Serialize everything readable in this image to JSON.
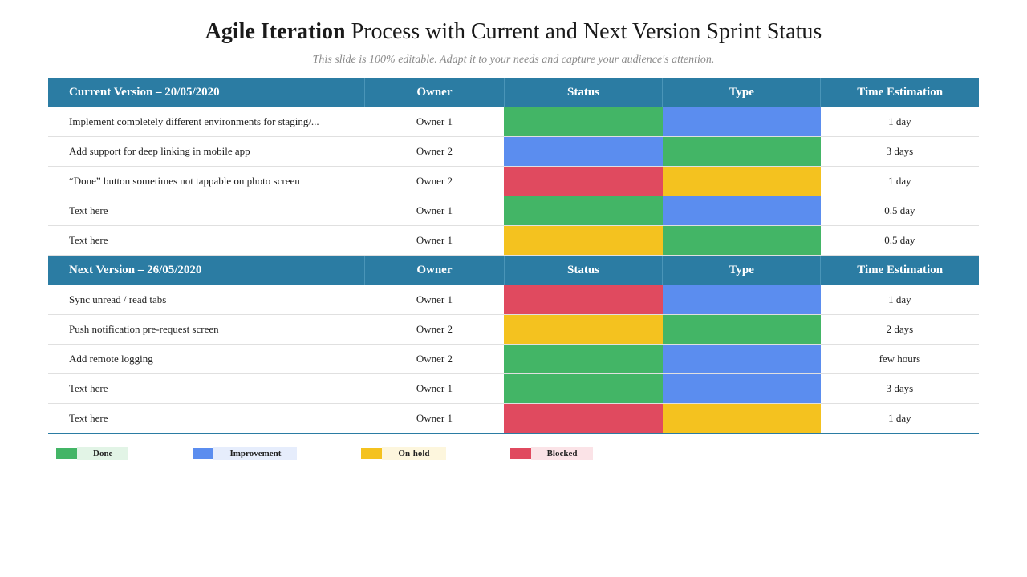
{
  "title_bold": "Agile Iteration",
  "title_rest": " Process with Current and Next Version Sprint Status",
  "subtitle": "This slide is 100% editable. Adapt it to your needs and capture your audience's attention.",
  "colors": {
    "done": "#43b566",
    "improvement": "#5b8def",
    "onhold": "#f4c21f",
    "blocked": "#e04a5f"
  },
  "columns": [
    "Owner",
    "Status",
    "Type",
    "Time Estimation"
  ],
  "sections": [
    {
      "title": "Current Version – 20/05/2020",
      "rows": [
        {
          "task": "Implement completely different environments for staging/...",
          "owner": "Owner 1",
          "status": "done",
          "type": "improvement",
          "time": "1 day"
        },
        {
          "task": "Add support for deep linking in mobile app",
          "owner": "Owner 2",
          "status": "improvement",
          "type": "done",
          "time": "3 days"
        },
        {
          "task": "“Done” button sometimes not tappable on photo screen",
          "owner": "Owner 2",
          "status": "blocked",
          "type": "onhold",
          "time": "1 day"
        },
        {
          "task": "Text here",
          "owner": "Owner 1",
          "status": "done",
          "type": "improvement",
          "time": "0.5 day"
        },
        {
          "task": "Text here",
          "owner": "Owner 1",
          "status": "onhold",
          "type": "done",
          "time": "0.5 day"
        }
      ]
    },
    {
      "title": "Next Version – 26/05/2020",
      "rows": [
        {
          "task": "Sync unread / read tabs",
          "owner": "Owner 1",
          "status": "blocked",
          "type": "improvement",
          "time": "1 day"
        },
        {
          "task": "Push notification pre-request screen",
          "owner": "Owner 2",
          "status": "onhold",
          "type": "done",
          "time": "2 days"
        },
        {
          "task": "Add remote logging",
          "owner": "Owner 2",
          "status": "done",
          "type": "improvement",
          "time": "few hours"
        },
        {
          "task": "Text here",
          "owner": "Owner 1",
          "status": "done",
          "type": "improvement",
          "time": "3 days"
        },
        {
          "task": "Text here",
          "owner": "Owner 1",
          "status": "blocked",
          "type": "onhold",
          "time": "1 day"
        }
      ]
    }
  ],
  "legend": [
    {
      "key": "done",
      "label": "Done"
    },
    {
      "key": "improvement",
      "label": "Improvement"
    },
    {
      "key": "onhold",
      "label": "On-hold"
    },
    {
      "key": "blocked",
      "label": "Blocked"
    }
  ]
}
